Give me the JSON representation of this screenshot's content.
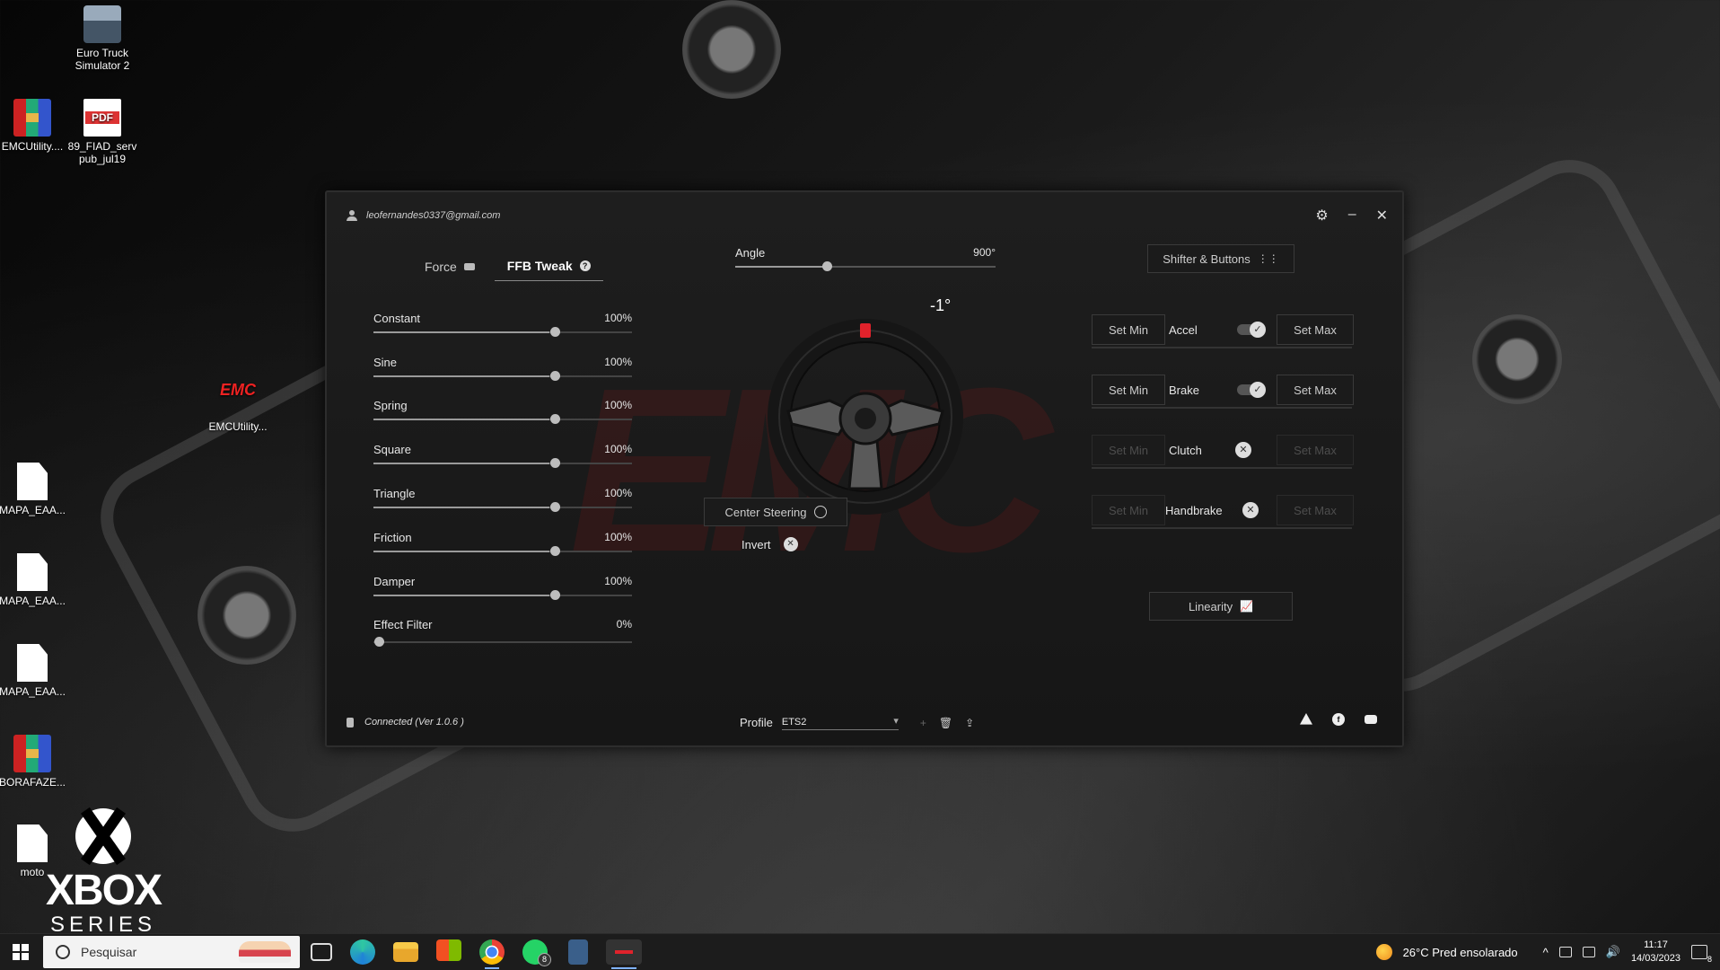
{
  "desktop": {
    "icons": [
      {
        "label": "Euro Truck Simulator 2",
        "type": "truck"
      },
      {
        "label": "EMCUtility....",
        "type": "rar"
      },
      {
        "label": "89_FIAD_serv pub_jul19",
        "type": "pdf",
        "badge": "PDF"
      },
      {
        "label": "EMCUtility...",
        "type": "emc",
        "logo": "EMC"
      },
      {
        "label": "MAPA_EAA...",
        "type": "file"
      },
      {
        "label": "MAPA_EAA...",
        "type": "file"
      },
      {
        "label": "MAPA_EAA...",
        "type": "file"
      },
      {
        "label": "BORAFAZE...",
        "type": "rar"
      },
      {
        "label": "moto",
        "type": "file"
      }
    ],
    "wallpaper_text": {
      "line1": "XBOX",
      "line2": "SERIES X"
    }
  },
  "app": {
    "user_email": "leofernandes0337@gmail.com",
    "watermark": "EMC",
    "tabs": [
      {
        "label": "Force",
        "icon": "motor-icon",
        "active": false
      },
      {
        "label": "FFB Tweak",
        "icon": "info-icon",
        "active": true
      }
    ],
    "effects": [
      {
        "label": "Constant",
        "value": "100%",
        "level": 100
      },
      {
        "label": "Sine",
        "value": "100%",
        "level": 100
      },
      {
        "label": "Spring",
        "value": "100%",
        "level": 100
      },
      {
        "label": "Square",
        "value": "100%",
        "level": 100
      },
      {
        "label": "Triangle",
        "value": "100%",
        "level": 100
      },
      {
        "label": "Friction",
        "value": "100%",
        "level": 100
      },
      {
        "label": "Damper",
        "value": "100%",
        "level": 100
      },
      {
        "label": "Effect Filter",
        "value": "0%",
        "level": 0
      }
    ],
    "angle": {
      "label": "Angle",
      "value": "900°",
      "level_fraction": 0.35
    },
    "steering_degrees": "-1°",
    "center_steering_label": "Center Steering",
    "invert_label": "Invert",
    "shifter_buttons_label": "Shifter & Buttons",
    "pedals": [
      {
        "name": "Accel",
        "enabled": true,
        "set_min": "Set Min",
        "set_max": "Set Max"
      },
      {
        "name": "Brake",
        "enabled": true,
        "set_min": "Set Min",
        "set_max": "Set Max"
      },
      {
        "name": "Clutch",
        "enabled": false,
        "set_min": "Set Min",
        "set_max": "Set Max"
      },
      {
        "name": "Handbrake",
        "enabled": false,
        "set_min": "Set Min",
        "set_max": "Set Max"
      }
    ],
    "linearity_label": "Linearity",
    "status": "Connected (Ver 1.0.6 )",
    "profile_label": "Profile",
    "profile_value": "ETS2"
  },
  "taskbar": {
    "search_placeholder": "Pesquisar",
    "weather": "26°C  Pred ensolarado",
    "time": "11:17",
    "date": "14/03/2023",
    "notification_count": "8",
    "whatsapp_badge": "8"
  },
  "colors": {
    "accent_red": "#e0222b",
    "window_bg": "#1a1a1a"
  }
}
